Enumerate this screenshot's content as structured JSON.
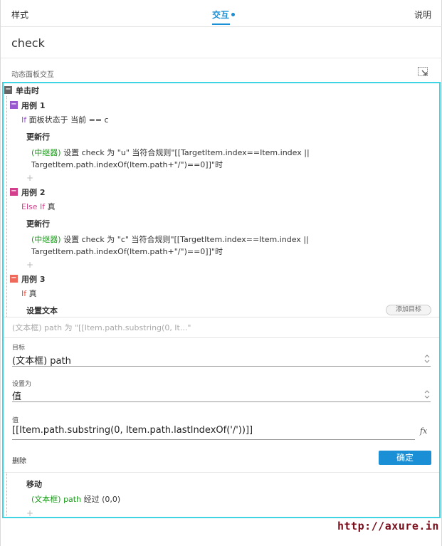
{
  "tabs": {
    "style": "样式",
    "interactions": "交互",
    "notes": "说明"
  },
  "widget": {
    "name": "check"
  },
  "section": {
    "label": "动态面板交互"
  },
  "event": {
    "name": "单击时",
    "toggle": "−"
  },
  "case1": {
    "label": "用例 1",
    "toggle": "−",
    "if_kw": "If",
    "condition": "面板状态于 当前 == c",
    "action": "更新行",
    "target": "(中继器)",
    "detail_line1": " 设置 check 为 \"u\" 当符合规则\"[[TargetItem.index==Item.index ||",
    "detail_line2": "TargetItem.path.indexOf(Item.path+\"/\")==0]]\"时",
    "plus": "+"
  },
  "case2": {
    "label": "用例 2",
    "toggle": "−",
    "if_kw": "Else If",
    "condition": "真",
    "action": "更新行",
    "target": "(中继器)",
    "detail_line1": " 设置 check 为 \"c\" 当符合规则\"[[TargetItem.index==Item.index ||",
    "detail_line2": "TargetItem.path.indexOf(Item.path+\"/\")==0]]\"时",
    "plus": "+"
  },
  "case3": {
    "label": "用例 3",
    "toggle": "−",
    "if_kw": "If",
    "condition": "真",
    "action": "设置文本",
    "add_target": "添加目标",
    "summary": "(文本框) path 为 \"[[Item.path.substring(0, It...\"",
    "move_action": "移动",
    "move_target": "(文本框) path",
    "move_detail": " 经过 (0,0)",
    "plus": "+"
  },
  "editor": {
    "target_label": "目标",
    "target_value": "(文本框) path",
    "set_to_label": "设置为",
    "set_to_value": "值",
    "value_label": "值",
    "value_text": "[[Item.path.substring(0, Item.path.lastIndexOf('/'))]]",
    "fx": "fx",
    "delete": "删除",
    "ok": "确定"
  },
  "watermark": "http://axure.in",
  "colors": {
    "accent": "#1a8fd6",
    "highlight_border": "#3fd4e3",
    "case1_icon": "#9b59d0",
    "case2_icon": "#d43f8d",
    "case3_icon": "#f06a5c",
    "event_icon": "#666666",
    "target_green": "#1c9b1c"
  }
}
